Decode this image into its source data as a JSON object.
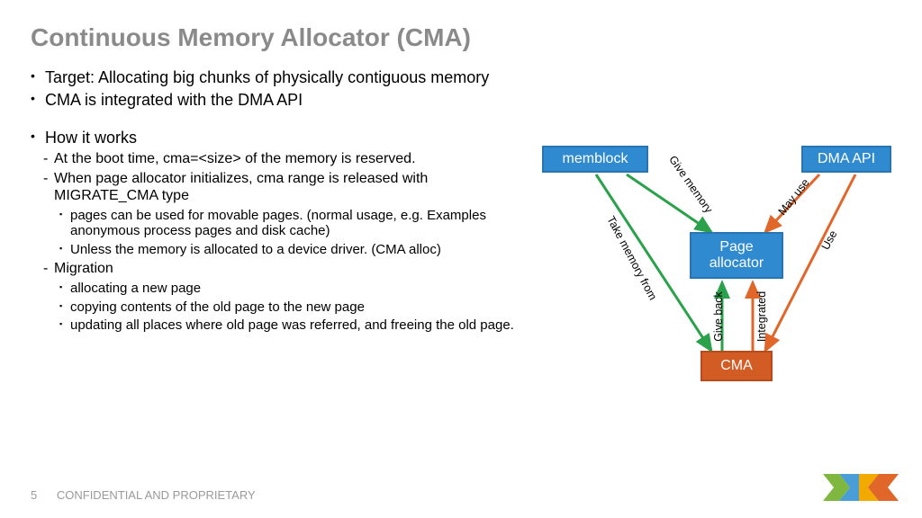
{
  "title": "Continuous Memory Allocator (CMA)",
  "bullets": {
    "p1": "Target: Allocating big chunks of physically contiguous memory",
    "p2": "CMA is integrated with the DMA API",
    "p3": "How it works",
    "p3a": "At the boot time, cma=<size> of the memory is reserved.",
    "p3b": "When page allocator initializes, cma range is released with MIGRATE_CMA type",
    "p3b1": "pages can be used for movable pages. (normal usage, e.g. Examples anonymous process pages and disk cache)",
    "p3b2": "Unless the memory is allocated to a device driver. (CMA alloc)",
    "p3c": "Migration",
    "p3c1": "allocating a new page",
    "p3c2": "copying contents of the old page to the new page",
    "p3c3": "updating all places where old page was referred, and freeing the old page."
  },
  "diagram": {
    "memblock": "memblock",
    "dmaapi": "DMA API",
    "pagealloc": "Page allocator",
    "cma": "CMA",
    "edge_give_memory": "Give memory",
    "edge_take_memory": "Take memory from",
    "edge_may_use": "May use",
    "edge_use": "Use",
    "edge_give_back": "Give back",
    "edge_integrated": "Integrated"
  },
  "footer": {
    "page": "5",
    "text": "CONFIDENTIAL AND PROPRIETARY"
  }
}
